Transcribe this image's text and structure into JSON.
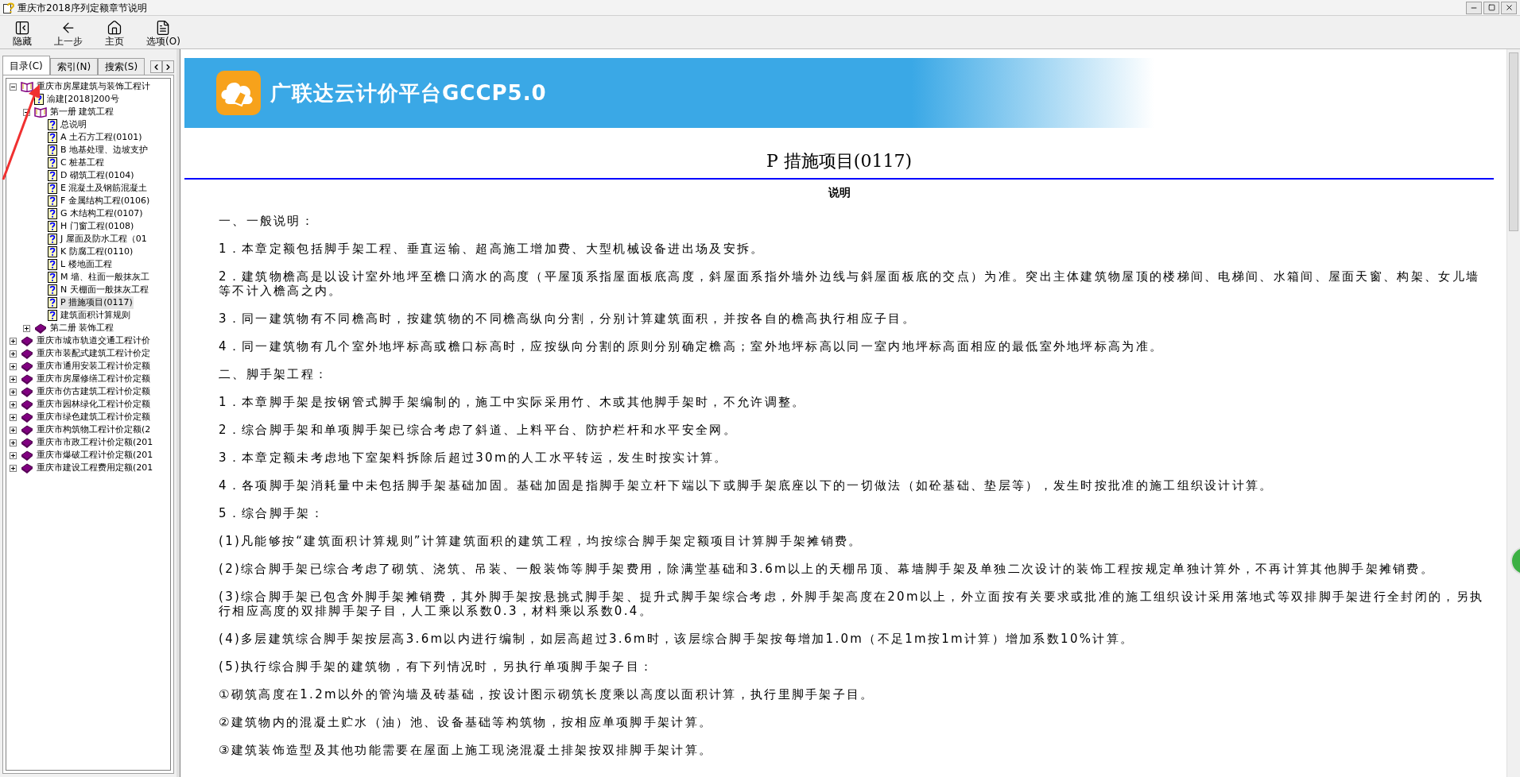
{
  "window": {
    "title": "重庆市2018序列定额章节说明"
  },
  "toolbar": [
    "隐藏",
    "上一步",
    "主页",
    "选项(O)"
  ],
  "tabs": [
    {
      "label": "目录(C)",
      "selected": true
    },
    {
      "label": "索引(N)",
      "selected": false
    },
    {
      "label": "搜索(S)",
      "selected": false
    }
  ],
  "tree": [
    {
      "label": "重庆市房屋建筑与装饰工程计",
      "kind": "book-open",
      "expanded": true,
      "selected": false,
      "children": [
        {
          "label": "渝建[2018]200号",
          "kind": "page",
          "selected": false
        },
        {
          "label": "第一册 建筑工程",
          "kind": "book-open",
          "expanded": true,
          "selected": false,
          "children": [
            {
              "label": "总说明",
              "kind": "page",
              "selected": false
            },
            {
              "label": "A 土石方工程(0101)",
              "kind": "page",
              "selected": false
            },
            {
              "label": "B 地基处理、边坡支护",
              "kind": "page",
              "selected": false
            },
            {
              "label": "C 桩基工程",
              "kind": "page",
              "selected": false
            },
            {
              "label": "D 砌筑工程(0104)",
              "kind": "page",
              "selected": false
            },
            {
              "label": "E 混凝土及钢筋混凝土",
              "kind": "page",
              "selected": false
            },
            {
              "label": "F 金属结构工程(0106)",
              "kind": "page",
              "selected": false
            },
            {
              "label": "G 木结构工程(0107)",
              "kind": "page",
              "selected": false
            },
            {
              "label": "H 门窗工程(0108)",
              "kind": "page",
              "selected": false
            },
            {
              "label": "J 屋面及防水工程（01",
              "kind": "page",
              "selected": false
            },
            {
              "label": "K 防腐工程(0110)",
              "kind": "page",
              "selected": false
            },
            {
              "label": "L 楼地面工程",
              "kind": "page",
              "selected": false
            },
            {
              "label": "M 墙、柱面一般抹灰工",
              "kind": "page",
              "selected": false
            },
            {
              "label": "N 天棚面一般抹灰工程",
              "kind": "page",
              "selected": false
            },
            {
              "label": "P 措施项目(0117)",
              "kind": "page",
              "selected": true
            },
            {
              "label": "建筑面积计算规则",
              "kind": "page",
              "selected": false
            }
          ]
        },
        {
          "label": "第二册 装饰工程",
          "kind": "book",
          "expanded": false,
          "selected": false
        }
      ]
    },
    {
      "label": "重庆市城市轨道交通工程计价",
      "kind": "book",
      "expanded": false,
      "selected": false
    },
    {
      "label": "重庆市装配式建筑工程计价定",
      "kind": "book",
      "expanded": false,
      "selected": false
    },
    {
      "label": "重庆市通用安装工程计价定额",
      "kind": "book",
      "expanded": false,
      "selected": false
    },
    {
      "label": "重庆市房屋修缮工程计价定额",
      "kind": "book",
      "expanded": false,
      "selected": false
    },
    {
      "label": "重庆市仿古建筑工程计价定额",
      "kind": "book",
      "expanded": false,
      "selected": false
    },
    {
      "label": "重庆市园林绿化工程计价定额",
      "kind": "book",
      "expanded": false,
      "selected": false
    },
    {
      "label": "重庆市绿色建筑工程计价定额",
      "kind": "book",
      "expanded": false,
      "selected": false
    },
    {
      "label": "重庆市构筑物工程计价定额(2",
      "kind": "book",
      "expanded": false,
      "selected": false
    },
    {
      "label": "重庆市市政工程计价定额(201",
      "kind": "book",
      "expanded": false,
      "selected": false
    },
    {
      "label": "重庆市爆破工程计价定额(201",
      "kind": "book",
      "expanded": false,
      "selected": false
    },
    {
      "label": "重庆市建设工程费用定额(201",
      "kind": "book",
      "expanded": false,
      "selected": false
    }
  ],
  "banner": {
    "title": "广联达云计价平台GCCP5.0"
  },
  "document": {
    "title": "P 措施项目(0117)",
    "subtitle": "说明",
    "paragraphs": [
      "一、一般说明：",
      "1．本章定额包括脚手架工程、垂直运输、超高施工增加费、大型机械设备进出场及安拆。",
      "2．建筑物檐高是以设计室外地坪至檐口滴水的高度（平屋顶系指屋面板底高度，斜屋面系指外墙外边线与斜屋面板底的交点）为准。突出主体建筑物屋顶的楼梯间、电梯间、水箱间、屋面天窗、构架、女儿墙等不计入檐高之内。",
      "3．同一建筑物有不同檐高时，按建筑物的不同檐高纵向分割，分别计算建筑面积，并按各自的檐高执行相应子目。",
      "4．同一建筑物有几个室外地坪标高或檐口标高时，应按纵向分割的原则分别确定檐高；室外地坪标高以同一室内地坪标高面相应的最低室外地坪标高为准。",
      "二、脚手架工程：",
      "1．本章脚手架是按钢管式脚手架编制的，施工中实际采用竹、木或其他脚手架时，不允许调整。",
      "2．综合脚手架和单项脚手架已综合考虑了斜道、上料平台、防护栏杆和水平安全网。",
      "3．本章定额未考虑地下室架料拆除后超过30m的人工水平转运，发生时按实计算。",
      "4．各项脚手架消耗量中未包括脚手架基础加固。基础加固是指脚手架立杆下端以下或脚手架底座以下的一切做法（如砼基础、垫层等），发生时按批准的施工组织设计计算。",
      "5．综合脚手架：",
      "(1)凡能够按“建筑面积计算规则”计算建筑面积的建筑工程，均按综合脚手架定额项目计算脚手架摊销费。",
      "(2)综合脚手架已综合考虑了砌筑、浇筑、吊装、一般装饰等脚手架费用，除满堂基础和3.6m以上的天棚吊顶、幕墙脚手架及单独二次设计的装饰工程按规定单独计算外，不再计算其他脚手架摊销费。",
      "(3)综合脚手架已包含外脚手架摊销费，其外脚手架按悬挑式脚手架、提升式脚手架综合考虑，外脚手架高度在20m以上，外立面按有关要求或批准的施工组织设计采用落地式等双排脚手架进行全封闭的，另执行相应高度的双排脚手架子目，人工乘以系数0.3，材料乘以系数0.4。",
      "(4)多层建筑综合脚手架按层高3.6m以内进行编制，如层高超过3.6m时，该层综合脚手架按每增加1.0m（不足1m按1m计算）增加系数10%计算。",
      "(5)执行综合脚手架的建筑物，有下列情况时，另执行单项脚手架子目：",
      "①砌筑高度在1.2m以外的管沟墙及砖基础，按设计图示砌筑长度乘以高度以面积计算，执行里脚手架子目。",
      "②建筑物内的混凝土贮水（油）池、设备基础等构筑物，按相应单项脚手架计算。",
      "③建筑装饰造型及其他功能需要在屋面上施工现浇混凝土排架按双排脚手架计算。"
    ]
  }
}
